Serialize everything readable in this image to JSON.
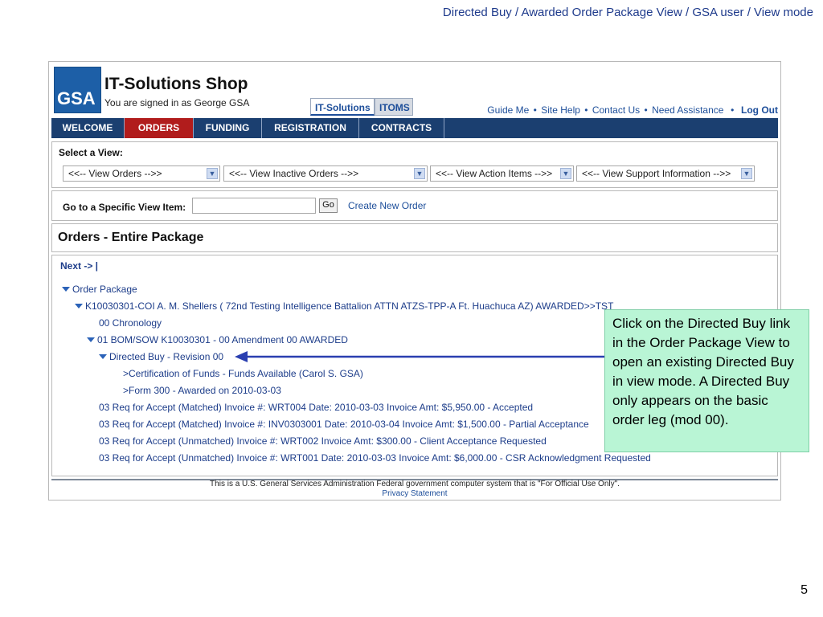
{
  "slide": {
    "title": "Directed  Buy / Awarded Order Package View / GSA user / View mode",
    "page_number": "5"
  },
  "header": {
    "logo_text": "GSA",
    "app_title": "IT-Solutions Shop",
    "signed_in": "You are signed in as George GSA",
    "top_tabs": [
      "IT-Solutions",
      "ITOMS"
    ],
    "util_links": [
      "Guide Me",
      "Site Help",
      "Contact Us",
      "Need Assistance"
    ],
    "logout": "Log Out"
  },
  "nav": {
    "items": [
      "WELCOME",
      "ORDERS",
      "FUNDING",
      "REGISTRATION",
      "CONTRACTS"
    ],
    "active": "ORDERS"
  },
  "view_panel": {
    "label": "Select a View:",
    "selects": [
      "<<-- View Orders -->>",
      "<<-- View Inactive Orders -->>",
      "<<-- View Action Items -->>",
      "<<-- View Support Information -->>"
    ]
  },
  "goto_panel": {
    "label": "Go to a Specific View Item:",
    "input_value": "",
    "go_label": "Go",
    "create_link": "Create New Order"
  },
  "orders": {
    "title": "Orders - Entire Package"
  },
  "main": {
    "next": "Next -> |",
    "tree": [
      {
        "text": "Order Package",
        "expanded": true
      },
      {
        "text": "K10030301-COI A. M. Shellers  ( 72nd Testing Intelligence Battalion ATTN ATZS-TPP-A Ft. Huachuca AZ) AWARDED>>TST",
        "expanded": true
      },
      {
        "text": "00 Chronology",
        "expanded": false
      },
      {
        "text": "01 BOM/SOW K10030301 - 00 Amendment 00 AWARDED",
        "expanded": true
      },
      {
        "text": "Directed Buy - Revision 00",
        "expanded": true
      },
      {
        "text": ">Certification of Funds - Funds Available (Carol S. GSA)",
        "expanded": false
      },
      {
        "text": ">Form 300 - Awarded on 2010-03-03",
        "expanded": false
      },
      {
        "text": "03 Req for Accept (Matched) Invoice #: WRT004 Date: 2010-03-03 Invoice Amt: $5,950.00 - Accepted",
        "expanded": false
      },
      {
        "text": "03 Req for Accept (Matched) Invoice #: INV0303001 Date: 2010-03-04 Invoice Amt: $1,500.00 - Partial Acceptance",
        "expanded": false
      },
      {
        "text": "03 Req for Accept (Unmatched) Invoice #: WRT002 Invoice Amt: $300.00 - Client Acceptance Requested",
        "expanded": false
      },
      {
        "text": "03 Req for Accept (Unmatched) Invoice #: WRT001 Date: 2010-03-03 Invoice Amt: $6,000.00 - CSR Acknowledgment Requested",
        "expanded": false
      }
    ]
  },
  "footer": {
    "notice": "This is a U.S. General Services Administration Federal government computer system that is \"For Official Use Only\".",
    "privacy": "Privacy Statement"
  },
  "callout": {
    "text": "Click on the Directed Buy link in the Order Package View to open an existing Directed Buy in view mode.  A Directed Buy only appears on the basic order leg (mod 00)."
  },
  "colors": {
    "nav_bg": "#1b3f70",
    "nav_active": "#b11c1c",
    "link": "#1d3d8a",
    "callout_bg": "#b9f5d5",
    "arrow": "#2a3fb0"
  }
}
